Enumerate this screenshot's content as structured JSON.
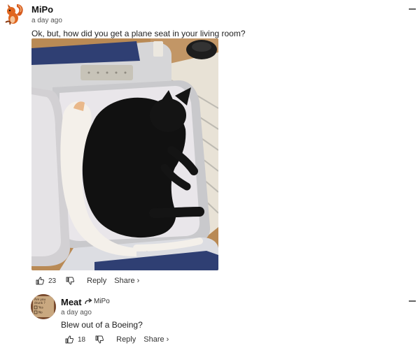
{
  "comments": [
    {
      "author": "MiPo",
      "time": "a day ago",
      "text": "Ok, but, how did you get a plane seat in your living room?",
      "likes": "23",
      "reply_label": "Reply",
      "share_label": "Share ›"
    },
    {
      "author": "Meat",
      "reply_to": "MiPo",
      "time": "a day ago",
      "text": "Blew out of a Boeing?",
      "likes": "18",
      "reply_label": "Reply",
      "share_label": "Share ›",
      "avatar_text": [
        "Are you",
        "drunk ?",
        "Yes",
        "No"
      ]
    }
  ],
  "image": {
    "seat_label": "RECARO"
  },
  "colors": {
    "seat_blue": "#2f3f73",
    "seat_grey": "#d6d6d8",
    "cat_black": "#111111",
    "cat_white": "#f4f0ea",
    "floor": "#b98a55"
  }
}
